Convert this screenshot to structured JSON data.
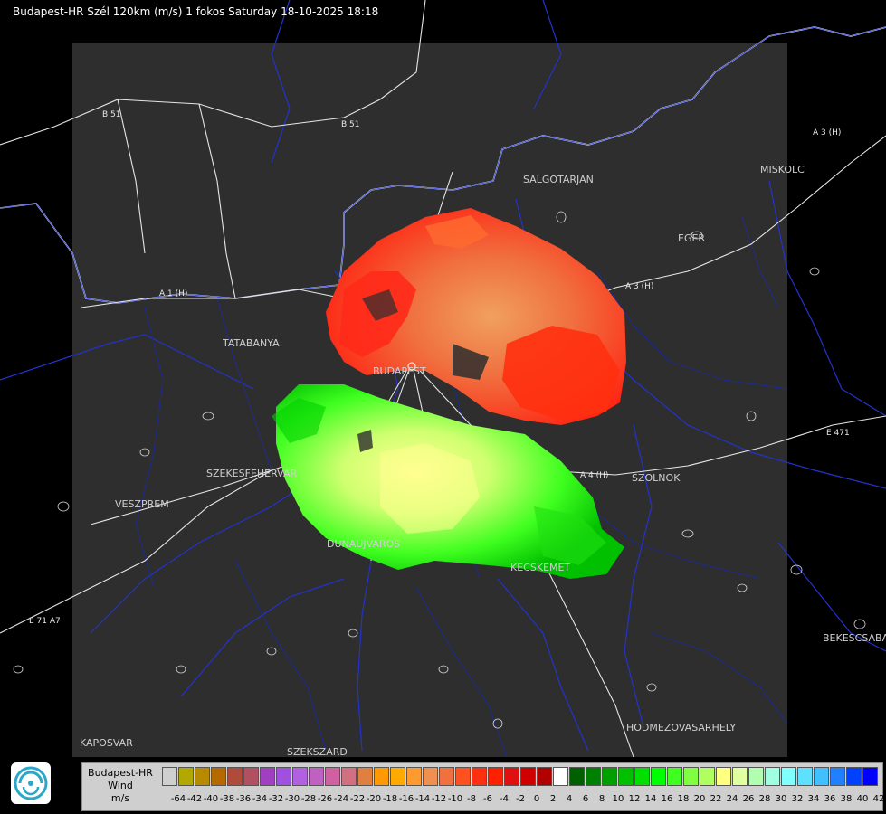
{
  "header": {
    "title": "Budapest-HR Szél 120km (m/s) 1 fokos Saturday 18-10-2025 18:18"
  },
  "cities": [
    {
      "name": "SALGOTARJAN"
    },
    {
      "name": "MISKOLC"
    },
    {
      "name": "EGER"
    },
    {
      "name": "TATABANYA"
    },
    {
      "name": "BUDAPEST"
    },
    {
      "name": "SZEKESFEHERVAR"
    },
    {
      "name": "VESZPREM"
    },
    {
      "name": "SZOLNOK"
    },
    {
      "name": "DUNAUJVAROS"
    },
    {
      "name": "KECSKEMET"
    },
    {
      "name": "BEKESCSABA"
    },
    {
      "name": "HODMEZOVASARHELY"
    },
    {
      "name": "KAPOSVAR"
    },
    {
      "name": "SZEKSZARD"
    }
  ],
  "roads": [
    {
      "name": "B 51"
    },
    {
      "name": "B 51"
    },
    {
      "name": "A 1 (H)"
    },
    {
      "name": "A 3 (H)"
    },
    {
      "name": "A 3 (H)"
    },
    {
      "name": "E 471"
    },
    {
      "name": "A 4 (H)"
    },
    {
      "name": "E 71 A7"
    }
  ],
  "legend": {
    "title_line1": "Budapest-HR",
    "title_line2": "Wind",
    "unit": "m/s",
    "colors": [
      "#cfcfcf",
      "#b3a800",
      "#b88a00",
      "#b56a00",
      "#b04a3a",
      "#b05060",
      "#a040c0",
      "#a050e0",
      "#b060e0",
      "#c060c0",
      "#d060a0",
      "#d07080",
      "#e08040",
      "#ff9900",
      "#ffaa00",
      "#ff9a30",
      "#f09050",
      "#f07040",
      "#ff5020",
      "#ff3010",
      "#ff2000",
      "#e01010",
      "#d00000",
      "#b00000",
      "#ffffff",
      "#006000",
      "#008000",
      "#00a000",
      "#00c000",
      "#00e000",
      "#00ff00",
      "#40ff20",
      "#80ff40",
      "#b0ff60",
      "#ffff80",
      "#e0ffa0",
      "#b0ffb0",
      "#a0ffe0",
      "#80ffff",
      "#60e0ff",
      "#40c0ff",
      "#2080ff",
      "#0040ff",
      "#0000ff"
    ],
    "ticks": [
      "-64",
      "-42",
      "-40",
      "-38",
      "-36",
      "-34",
      "-32",
      "-30",
      "-28",
      "-26",
      "-24",
      "-22",
      "-20",
      "-18",
      "-16",
      "-14",
      "-12",
      "-10",
      "-8",
      "-6",
      "-4",
      "-2",
      "0",
      "2",
      "4",
      "6",
      "8",
      "10",
      "12",
      "14",
      "16",
      "18",
      "20",
      "22",
      "24",
      "26",
      "28",
      "30",
      "32",
      "34",
      "36",
      "38",
      "40",
      "42"
    ]
  }
}
